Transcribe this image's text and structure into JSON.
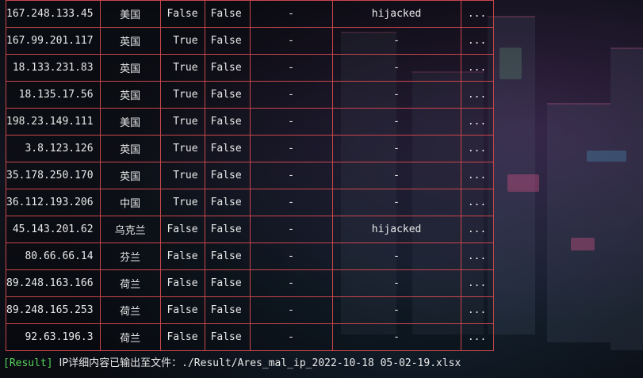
{
  "rows": [
    {
      "ip": "167.248.133.45",
      "country": "美国",
      "c3": "False",
      "c4": "False",
      "c5": "-",
      "c6": "hijacked",
      "c7": "..."
    },
    {
      "ip": "167.99.201.117",
      "country": "英国",
      "c3": "True",
      "c4": "False",
      "c5": "-",
      "c6": "-",
      "c7": "..."
    },
    {
      "ip": "18.133.231.83",
      "country": "英国",
      "c3": "True",
      "c4": "False",
      "c5": "-",
      "c6": "-",
      "c7": "..."
    },
    {
      "ip": "18.135.17.56",
      "country": "英国",
      "c3": "True",
      "c4": "False",
      "c5": "-",
      "c6": "-",
      "c7": "..."
    },
    {
      "ip": "198.23.149.111",
      "country": "美国",
      "c3": "True",
      "c4": "False",
      "c5": "-",
      "c6": "-",
      "c7": "..."
    },
    {
      "ip": "3.8.123.126",
      "country": "英国",
      "c3": "True",
      "c4": "False",
      "c5": "-",
      "c6": "-",
      "c7": "..."
    },
    {
      "ip": "35.178.250.170",
      "country": "英国",
      "c3": "True",
      "c4": "False",
      "c5": "-",
      "c6": "-",
      "c7": "..."
    },
    {
      "ip": "36.112.193.206",
      "country": "中国",
      "c3": "True",
      "c4": "False",
      "c5": "-",
      "c6": "-",
      "c7": "..."
    },
    {
      "ip": "45.143.201.62",
      "country": "乌克兰",
      "c3": "False",
      "c4": "False",
      "c5": "-",
      "c6": "hijacked",
      "c7": "..."
    },
    {
      "ip": "80.66.66.14",
      "country": "芬兰",
      "c3": "False",
      "c4": "False",
      "c5": "-",
      "c6": "-",
      "c7": "..."
    },
    {
      "ip": "89.248.163.166",
      "country": "荷兰",
      "c3": "False",
      "c4": "False",
      "c5": "-",
      "c6": "-",
      "c7": "..."
    },
    {
      "ip": "89.248.165.253",
      "country": "荷兰",
      "c3": "False",
      "c4": "False",
      "c5": "-",
      "c6": "-",
      "c7": "..."
    },
    {
      "ip": "92.63.196.3",
      "country": "荷兰",
      "c3": "False",
      "c4": "False",
      "c5": "-",
      "c6": "-",
      "c7": "..."
    }
  ],
  "result": {
    "tag": "[Result]",
    "message": "IP详细内容已输出至文件：",
    "path": "./Result/Ares_mal_ip_2022-10-18 05-02-19.xlsx"
  },
  "colors": {
    "grid": "#c9464c",
    "result_tag": "#58d25a",
    "text": "#e9e9e9"
  }
}
